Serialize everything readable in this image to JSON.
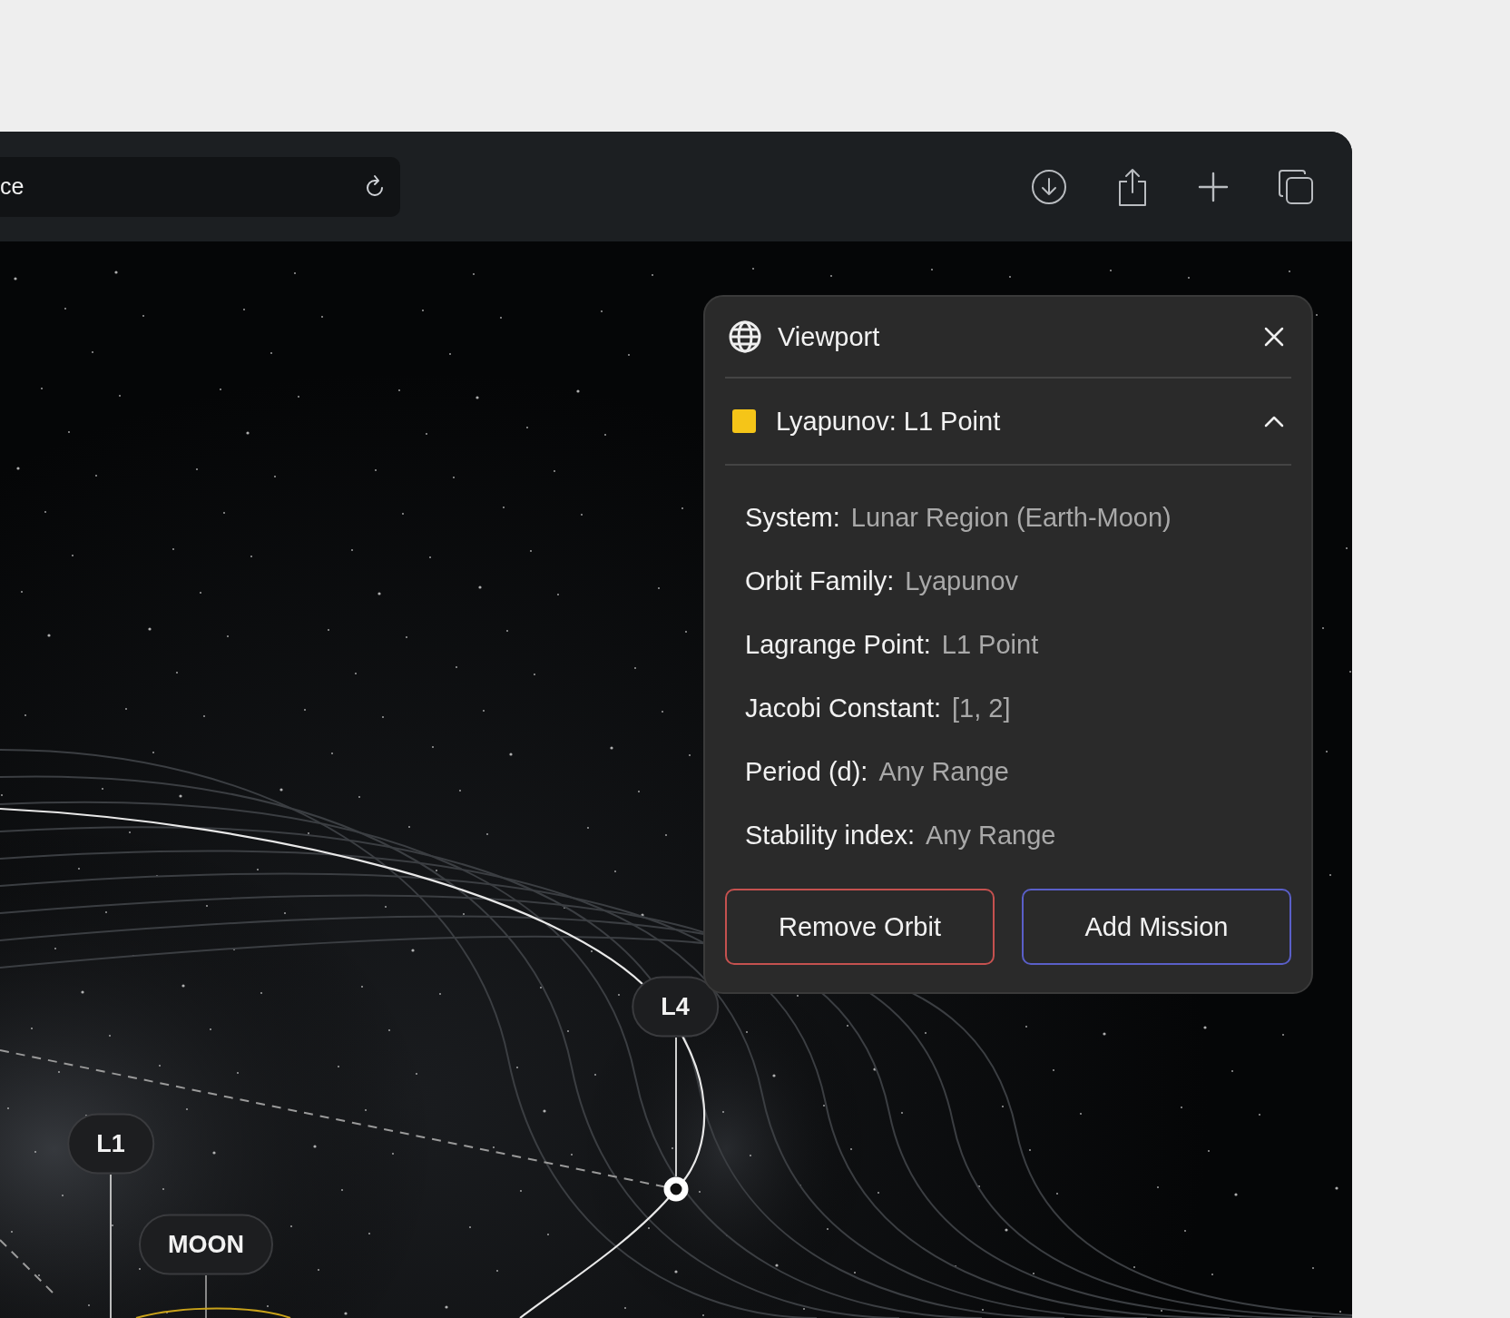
{
  "browser": {
    "address": "ce"
  },
  "viewport_panel": {
    "title": "Viewport",
    "orbit": {
      "name": "Lyapunov: L1 Point",
      "color": "#f5c518",
      "expanded": true
    },
    "properties": [
      {
        "label": "System:",
        "value": "Lunar Region (Earth-Moon)"
      },
      {
        "label": "Orbit Family:",
        "value": "Lyapunov"
      },
      {
        "label": "Lagrange Point:",
        "value": "L1 Point"
      },
      {
        "label": "Jacobi Constant:",
        "value": "[1, 2]"
      },
      {
        "label": "Period (d):",
        "value": "Any Range"
      },
      {
        "label": "Stability index:",
        "value": "Any Range"
      }
    ],
    "buttons": [
      {
        "label": "Remove Orbit",
        "kind": "danger"
      },
      {
        "label": "Add Mission",
        "kind": "primary"
      }
    ]
  },
  "map_labels": [
    {
      "label": "L4"
    },
    {
      "label": "L1"
    },
    {
      "label": "MOON"
    }
  ]
}
